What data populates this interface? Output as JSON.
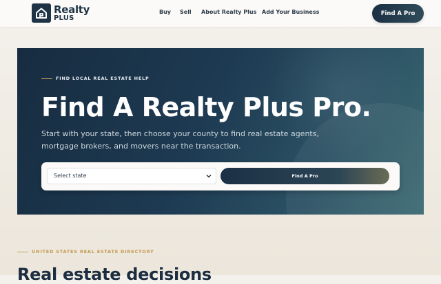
{
  "header": {
    "logo": {
      "line1": "Realty",
      "line2": "PLUS"
    },
    "nav": [
      {
        "label": "Buy"
      },
      {
        "label": "Sell"
      },
      {
        "label": "About Realty Plus"
      },
      {
        "label": "Add Your Business"
      }
    ],
    "cta_label": "Find A Pro"
  },
  "hero": {
    "eyebrow": "FIND LOCAL REAL ESTATE HELP",
    "title": "Find A Realty Plus Pro.",
    "description": "Start with your state, then choose your county to find real estate agents, mortgage brokers, and movers near the transaction.",
    "search": {
      "state_select_value": "Select state",
      "submit_label": "Find A Pro"
    }
  },
  "section": {
    "eyebrow": "UNITED STATES REAL ESTATE DIRECTORY",
    "title": "Real estate decisions"
  },
  "colors": {
    "navy": "#1b3045",
    "gold": "#c9a15a",
    "cream": "#f4f1ec"
  },
  "icons": {
    "logo": "house-icon",
    "select": "chevron-down-icon"
  }
}
